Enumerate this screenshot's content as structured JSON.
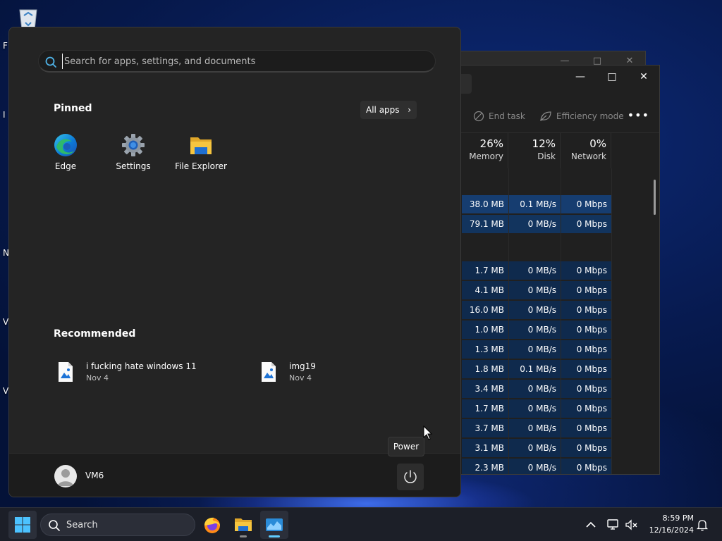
{
  "desktop": {
    "recycle_bin_icon": "recycle-bin-icon",
    "stub_labels": [
      "F",
      "I",
      "N",
      "V",
      "V"
    ]
  },
  "task_manager": {
    "toolbar": {
      "end_task": "End task",
      "efficiency_mode": "Efficiency mode",
      "more": "•••"
    },
    "columns": [
      {
        "pct": "26%",
        "name": "Memory"
      },
      {
        "pct": "12%",
        "name": "Disk"
      },
      {
        "pct": "0%",
        "name": "Network"
      }
    ],
    "rows": [
      {
        "memory": "38.0 MB",
        "disk": "0.1 MB/s",
        "network": "0 Mbps"
      },
      {
        "memory": "79.1 MB",
        "disk": "0 MB/s",
        "network": "0 Mbps"
      },
      {
        "memory": "1.7 MB",
        "disk": "0 MB/s",
        "network": "0 Mbps"
      },
      {
        "memory": "4.1 MB",
        "disk": "0 MB/s",
        "network": "0 Mbps"
      },
      {
        "memory": "16.0 MB",
        "disk": "0 MB/s",
        "network": "0 Mbps"
      },
      {
        "memory": "1.0 MB",
        "disk": "0 MB/s",
        "network": "0 Mbps"
      },
      {
        "memory": "1.3 MB",
        "disk": "0 MB/s",
        "network": "0 Mbps"
      },
      {
        "memory": "1.8 MB",
        "disk": "0.1 MB/s",
        "network": "0 Mbps"
      },
      {
        "memory": "3.4 MB",
        "disk": "0 MB/s",
        "network": "0 Mbps"
      },
      {
        "memory": "1.7 MB",
        "disk": "0 MB/s",
        "network": "0 Mbps"
      },
      {
        "memory": "3.7 MB",
        "disk": "0 MB/s",
        "network": "0 Mbps"
      },
      {
        "memory": "3.1 MB",
        "disk": "0 MB/s",
        "network": "0 Mbps"
      },
      {
        "memory": "2.3 MB",
        "disk": "0 MB/s",
        "network": "0 Mbps"
      }
    ]
  },
  "start_menu": {
    "search": {
      "placeholder": "Search for apps, settings, and documents",
      "value": ""
    },
    "pinned_title": "Pinned",
    "all_apps_label": "All apps",
    "pinned": [
      {
        "label": "Edge",
        "icon": "edge-icon"
      },
      {
        "label": "Settings",
        "icon": "settings-gear-icon"
      },
      {
        "label": "File Explorer",
        "icon": "folder-icon"
      }
    ],
    "recommended_title": "Recommended",
    "recommended": [
      {
        "name": "i fucking hate windows 11",
        "date": "Nov 4",
        "icon": "image-file-icon"
      },
      {
        "name": "img19",
        "date": "Nov 4",
        "icon": "image-file-icon"
      }
    ],
    "user": {
      "name": "VM6"
    },
    "power_tooltip": "Power"
  },
  "taskbar": {
    "search_label": "Search",
    "apps": [
      "start-icon",
      "firefox-icon",
      "file-explorer-icon",
      "task-manager-icon"
    ],
    "tray_icons": [
      "chevron-up-icon",
      "network-icon",
      "volume-muted-icon",
      "notification-bell-icon"
    ],
    "clock": {
      "time": "8:59 PM",
      "date": "12/16/2024"
    }
  },
  "colors": {
    "accent": "#60cdff",
    "start_bg": "#242424",
    "row_highlight": "#163d70",
    "edge_blue": "#0c7bd7",
    "edge_green": "#2fb86b",
    "folder_yellow": "#f6c53f"
  }
}
